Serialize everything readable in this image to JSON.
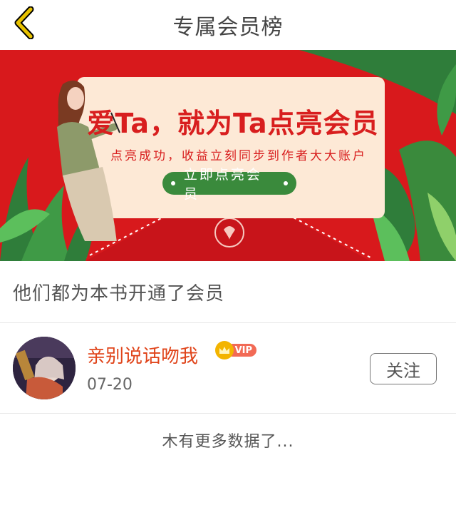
{
  "header": {
    "title": "专属会员榜"
  },
  "banner": {
    "title": "爱Ta，就为Ta点亮会员",
    "subtitle": "点亮成功，收益立刻同步到作者大大账户",
    "cta_label": "立即点亮会员"
  },
  "section": {
    "label": "他们都为本书开通了会员"
  },
  "members": [
    {
      "name": "亲别说话吻我",
      "badge": "VIP",
      "date": "07-20",
      "follow_label": "关注"
    }
  ],
  "footer": {
    "no_more_text": "木有更多数据了..."
  },
  "colors": {
    "accent": "#e8c200",
    "banner_red": "#d8191c",
    "name_orange": "#e0441a",
    "cta_green": "#3a8a3c"
  }
}
